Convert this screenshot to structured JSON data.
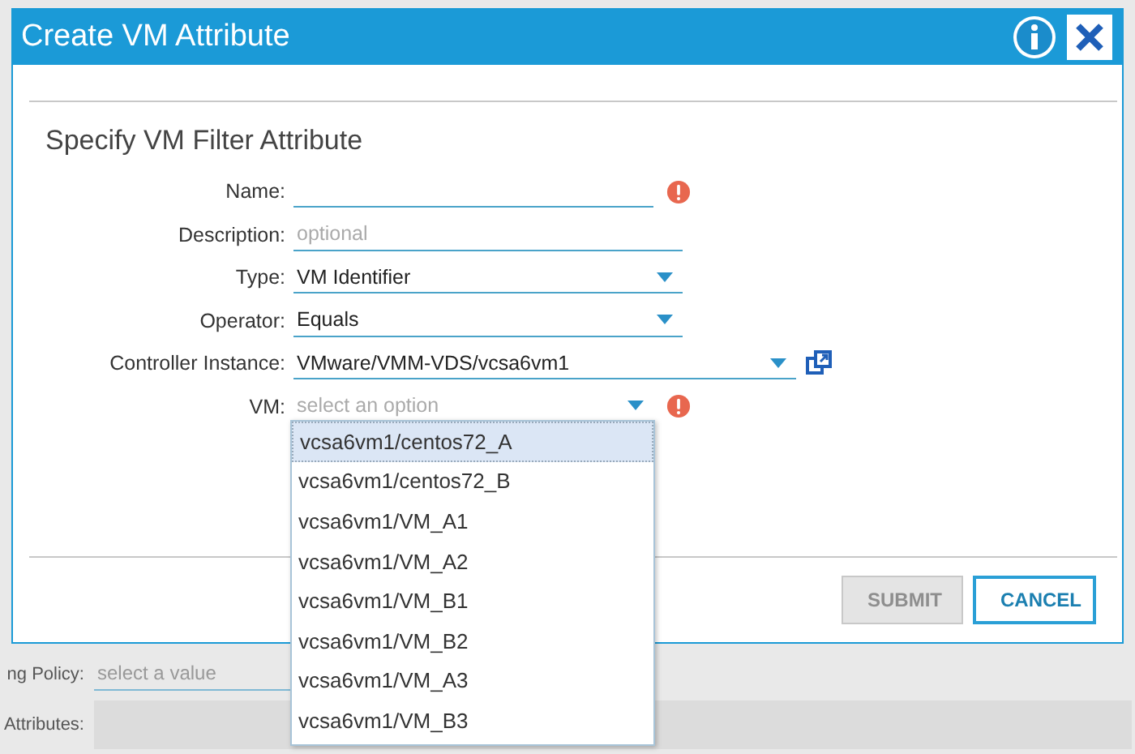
{
  "background": {
    "fields": [
      {
        "label": "ng Policy:",
        "kind": "select",
        "placeholder": "select a value"
      },
      {
        "label": "Attributes:",
        "kind": "area"
      }
    ]
  },
  "dialog": {
    "title": "Create VM Attribute",
    "section_title": "Specify VM Filter Attribute",
    "fields": [
      {
        "label": "Name:",
        "kind": "text",
        "error": true,
        "link": false
      },
      {
        "label": "Description:",
        "kind": "text",
        "placeholder": "optional",
        "error": false,
        "link": false
      },
      {
        "label": "Type:",
        "kind": "select",
        "value": "VM Identifier",
        "error": false,
        "link": false
      },
      {
        "label": "Operator:",
        "kind": "select",
        "value": "Equals",
        "error": false,
        "link": false
      },
      {
        "label": "Controller Instance:",
        "kind": "select",
        "value": "VMware/VMM-VDS/vcsa6vm1",
        "error": false,
        "link": true
      },
      {
        "label": "VM:",
        "kind": "select",
        "placeholder": "select an option",
        "error": true,
        "link": false
      }
    ],
    "options": [
      {
        "label": "vcsa6vm1/centos72_A",
        "selected": true
      },
      {
        "label": "vcsa6vm1/centos72_B",
        "selected": false
      },
      {
        "label": "vcsa6vm1/VM_A1",
        "selected": false
      },
      {
        "label": "vcsa6vm1/VM_A2",
        "selected": false
      },
      {
        "label": "vcsa6vm1/VM_B1",
        "selected": false
      },
      {
        "label": "vcsa6vm1/VM_B2",
        "selected": false
      },
      {
        "label": "vcsa6vm1/VM_A3",
        "selected": false
      },
      {
        "label": "vcsa6vm1/VM_B3",
        "selected": false
      }
    ],
    "buttons": [
      {
        "label": "SUBMIT",
        "disabled": true
      },
      {
        "label": "CANCEL",
        "disabled": false
      }
    ]
  }
}
